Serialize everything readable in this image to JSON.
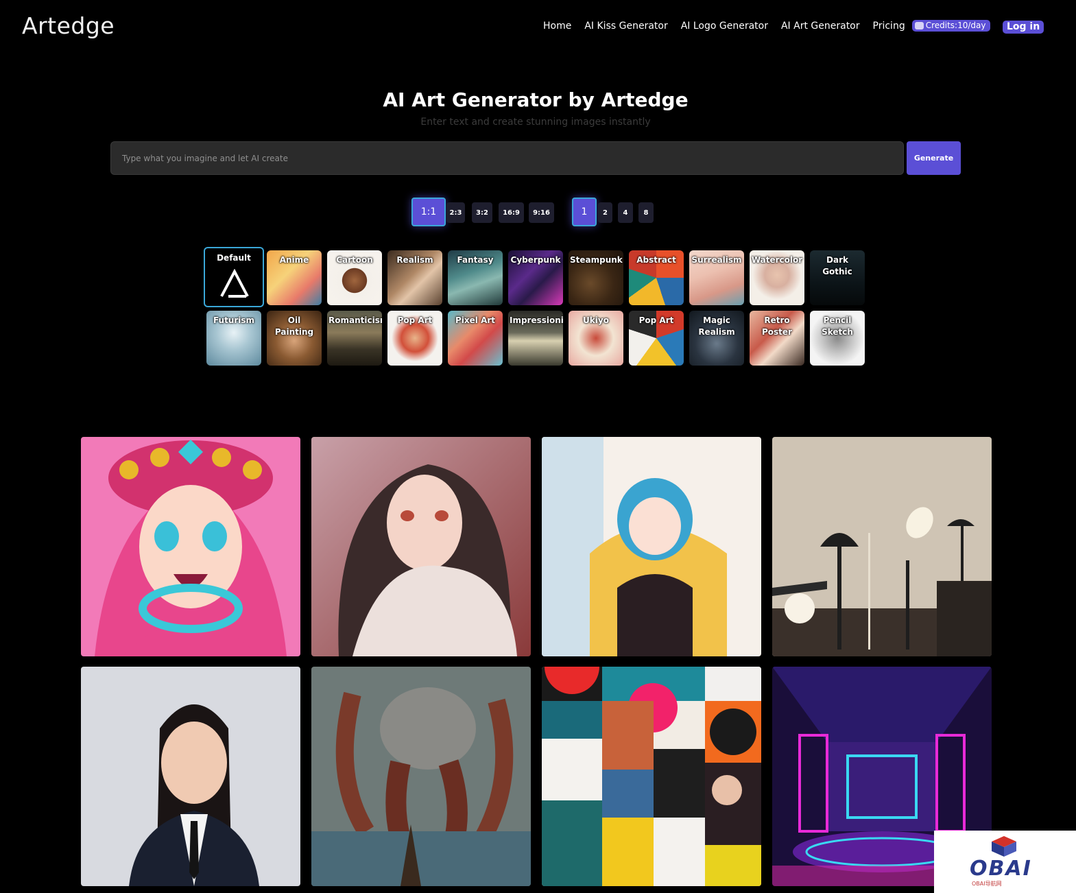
{
  "app": {
    "logo": "Artedge"
  },
  "nav": {
    "items": [
      "Home",
      "AI Kiss Generator",
      "AI Logo Generator",
      "AI Art Generator",
      "Pricing"
    ],
    "credits": "Credits:10/day",
    "login": "Log in"
  },
  "hero": {
    "title": "AI Art Generator by Artedge",
    "subtitle": "Enter text and create stunning images instantly"
  },
  "prompt": {
    "placeholder": "Type what you imagine and let AI create",
    "value": "",
    "button": "Generate"
  },
  "ratios": {
    "options": [
      "1:1",
      "2:3",
      "3:2",
      "16:9",
      "9:16"
    ],
    "selected": "1:1"
  },
  "counts": {
    "options": [
      "1",
      "2",
      "4",
      "8"
    ],
    "selected": "1"
  },
  "styles": {
    "selected": "Default",
    "row1": [
      "Default",
      "Anime",
      "Cartoon",
      "Realism",
      "Fantasy",
      "Cyberpunk",
      "Steampunk",
      "Abstract",
      "Surrealism",
      "Watercolor",
      "Dark Gothic"
    ],
    "row2": [
      "Futurism",
      "Oil Painting",
      "Romanticism",
      "Pop Art",
      "Pixel Art",
      "Impressionism",
      "Ukiyo",
      "Pop Art",
      "Magic Realism",
      "Retro Poster",
      "Pencil Sketch"
    ]
  },
  "gallery": [
    "anime-girl-pink-hat",
    "anime-girl-long-hair",
    "anime-girl-blue-hair-armchair",
    "desk-lamps",
    "portrait-woman-suit",
    "octopus-warrior",
    "abstract-collage",
    "cyberpunk-interior"
  ],
  "badge": {
    "text": "OBAI",
    "sub": "OBAI导航网"
  },
  "colors": {
    "accent": "#5b4fd6",
    "selected_border": "#3aa7d8",
    "background": "#000000"
  }
}
